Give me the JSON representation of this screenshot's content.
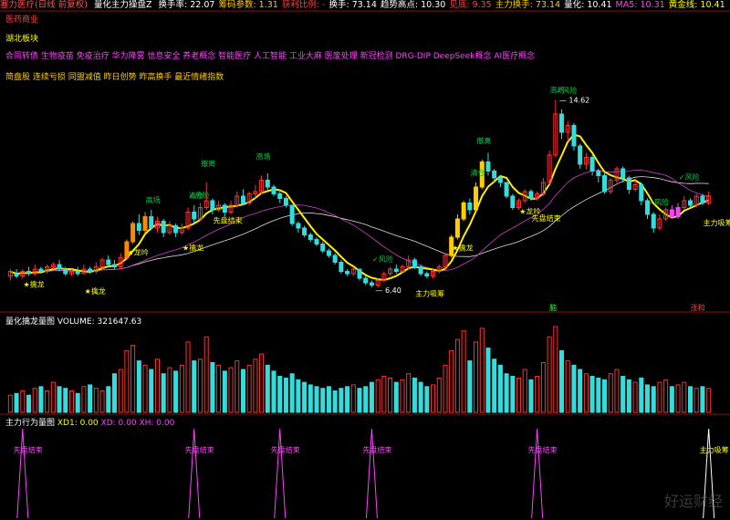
{
  "header": {
    "title": "塞力医疗(日线 前复权)",
    "indicator": "量化主力操盘Z",
    "items": [
      {
        "label": "换手率:",
        "value": "22.07",
        "color": "#ffffff"
      },
      {
        "label": "筹码参数:",
        "value": "1.31",
        "color": "#ffcc00"
      },
      {
        "label": "获利比例:",
        "value": "-",
        "color": "#ff4040"
      },
      {
        "label": "换手:",
        "value": "73.14",
        "color": "#ffffff"
      },
      {
        "label": "趋势高点:",
        "value": "10.30",
        "color": "#ffffff"
      },
      {
        "label": "见底:",
        "value": "9.35",
        "color": "#ff4040"
      },
      {
        "label": "主力换手:",
        "value": "73.14",
        "color": "#ffcc00"
      },
      {
        "label": "量化:",
        "value": "10.41",
        "color": "#ffffff"
      },
      {
        "label": "MA5:",
        "value": "10.31",
        "color": "#ff40ff"
      },
      {
        "label": "黄金线:",
        "value": "10.41",
        "color": "#ffff00"
      }
    ]
  },
  "left_labels": {
    "sector": "医药商业",
    "region": "湖北板块",
    "concepts1": "合同转债 生物疫苗 免疫治疗 华为降雾 信息安全 养老概念 智能医疗 人工智能 工业大麻 医废处理 新冠检测 DRG-DIP DeepSeek概念 AI医疗概念",
    "concepts2": "简盘股 连续亏损 同盟减值 昨日创势 昨高换手 最近情绪指数"
  },
  "chart_data": {
    "type": "candlestick",
    "price_axis": {
      "min": 5.8,
      "max": 15.2
    },
    "markers": {
      "high": "14.62",
      "low": "6.40"
    },
    "candles": [
      [
        6.9,
        7.1,
        7.2,
        6.7
      ],
      [
        7.0,
        6.9,
        7.2,
        6.8
      ],
      [
        6.9,
        7.1,
        7.2,
        6.8
      ],
      [
        7.1,
        7.0,
        7.3,
        6.9
      ],
      [
        7.0,
        7.2,
        7.4,
        6.9
      ],
      [
        7.2,
        7.1,
        7.3,
        7.0
      ],
      [
        7.1,
        7.3,
        7.4,
        7.0
      ],
      [
        7.3,
        7.4,
        7.5,
        7.2
      ],
      [
        7.4,
        7.2,
        7.6,
        7.1
      ],
      [
        7.2,
        7.0,
        7.3,
        6.9
      ],
      [
        7.0,
        7.1,
        7.2,
        6.9
      ],
      [
        7.1,
        7.0,
        7.3,
        6.9
      ],
      [
        7.0,
        7.2,
        7.4,
        7.0
      ],
      [
        7.2,
        7.1,
        7.3,
        7.0
      ],
      [
        7.1,
        7.3,
        7.5,
        7.0
      ],
      [
        7.3,
        7.6,
        7.7,
        7.2
      ],
      [
        7.6,
        7.4,
        7.8,
        7.3
      ],
      [
        7.4,
        7.3,
        7.6,
        7.2
      ],
      [
        7.3,
        7.7,
        7.9,
        7.2
      ],
      [
        7.7,
        8.4,
        8.5,
        7.6
      ],
      [
        8.4,
        9.2,
        9.3,
        8.3
      ],
      [
        9.2,
        8.9,
        9.6,
        8.7
      ],
      [
        8.9,
        9.5,
        9.7,
        8.8
      ],
      [
        9.5,
        9.0,
        9.8,
        8.9
      ],
      [
        9.0,
        9.3,
        9.5,
        8.8
      ],
      [
        9.3,
        8.8,
        9.4,
        8.6
      ],
      [
        8.8,
        9.1,
        9.3,
        8.7
      ],
      [
        9.1,
        8.8,
        9.2,
        8.6
      ],
      [
        8.8,
        9.0,
        9.2,
        8.7
      ],
      [
        9.0,
        9.7,
        9.9,
        8.9
      ],
      [
        9.7,
        9.4,
        10.0,
        9.2
      ],
      [
        9.4,
        9.9,
        10.1,
        9.3
      ],
      [
        9.9,
        10.2,
        11.0,
        9.8
      ],
      [
        10.2,
        9.8,
        10.3,
        9.6
      ],
      [
        9.8,
        10.0,
        10.2,
        9.7
      ],
      [
        10.0,
        9.7,
        10.1,
        9.5
      ],
      [
        9.7,
        10.0,
        10.2,
        9.6
      ],
      [
        10.0,
        10.4,
        10.6,
        9.9
      ],
      [
        10.4,
        10.1,
        10.7,
        10.0
      ],
      [
        10.1,
        10.5,
        10.6,
        10.0
      ],
      [
        10.5,
        10.6,
        10.9,
        10.3
      ],
      [
        10.6,
        11.1,
        11.3,
        10.5
      ],
      [
        11.1,
        10.8,
        11.4,
        10.6
      ],
      [
        10.8,
        10.5,
        10.9,
        10.4
      ],
      [
        10.5,
        10.3,
        10.6,
        10.1
      ],
      [
        10.3,
        10.0,
        10.4,
        9.9
      ],
      [
        10.0,
        9.2,
        10.0,
        9.1
      ],
      [
        9.2,
        9.0,
        9.3,
        8.8
      ],
      [
        9.0,
        8.7,
        9.1,
        8.6
      ],
      [
        8.7,
        8.5,
        8.8,
        8.4
      ],
      [
        8.5,
        8.3,
        8.6,
        8.2
      ],
      [
        8.3,
        8.0,
        8.4,
        7.9
      ],
      [
        8.0,
        7.8,
        8.1,
        7.7
      ],
      [
        7.8,
        7.5,
        7.9,
        7.4
      ],
      [
        7.5,
        7.1,
        7.6,
        7.0
      ],
      [
        7.1,
        7.0,
        7.2,
        6.9
      ],
      [
        7.0,
        7.2,
        7.3,
        6.9
      ],
      [
        7.2,
        6.8,
        7.2,
        6.7
      ],
      [
        6.8,
        6.6,
        6.9,
        6.5
      ],
      [
        6.6,
        6.5,
        6.7,
        6.4
      ],
      [
        6.5,
        6.7,
        6.8,
        6.4
      ],
      [
        6.7,
        7.0,
        7.1,
        6.6
      ],
      [
        7.0,
        7.2,
        7.3,
        6.9
      ],
      [
        7.2,
        7.1,
        7.4,
        7.0
      ],
      [
        7.1,
        7.3,
        7.4,
        7.0
      ],
      [
        7.3,
        7.6,
        7.8,
        7.2
      ],
      [
        7.6,
        7.3,
        7.7,
        7.2
      ],
      [
        7.3,
        7.0,
        7.4,
        6.9
      ],
      [
        7.0,
        6.9,
        7.1,
        6.8
      ],
      [
        6.9,
        7.1,
        7.2,
        6.8
      ],
      [
        7.1,
        7.3,
        7.4,
        7.0
      ],
      [
        7.3,
        7.8,
        7.9,
        7.2
      ],
      [
        7.8,
        8.6,
        8.7,
        7.7
      ],
      [
        8.6,
        9.4,
        9.6,
        8.5
      ],
      [
        9.4,
        10.1,
        10.2,
        9.3
      ],
      [
        10.1,
        9.8,
        10.3,
        9.6
      ],
      [
        9.8,
        10.8,
        11.0,
        9.7
      ],
      [
        10.8,
        11.9,
        12.0,
        10.7
      ],
      [
        11.9,
        11.5,
        12.3,
        11.3
      ],
      [
        11.5,
        11.2,
        11.6,
        11.0
      ],
      [
        11.2,
        11.0,
        11.3,
        10.8
      ],
      [
        11.0,
        10.4,
        11.0,
        10.3
      ],
      [
        10.4,
        9.9,
        10.5,
        9.8
      ],
      [
        9.9,
        10.2,
        10.3,
        9.8
      ],
      [
        10.2,
        10.6,
        10.7,
        10.1
      ],
      [
        10.6,
        10.3,
        10.7,
        10.2
      ],
      [
        10.3,
        10.5,
        10.6,
        10.2
      ],
      [
        10.5,
        11.0,
        11.2,
        10.4
      ],
      [
        11.0,
        12.2,
        12.4,
        10.9
      ],
      [
        12.2,
        14.0,
        14.62,
        12.1
      ],
      [
        14.0,
        13.2,
        14.2,
        12.9
      ],
      [
        13.2,
        13.5,
        13.7,
        12.8
      ],
      [
        13.5,
        12.6,
        13.6,
        12.4
      ],
      [
        12.6,
        11.8,
        12.7,
        11.6
      ],
      [
        11.8,
        12.1,
        12.3,
        11.6
      ],
      [
        12.1,
        11.5,
        12.2,
        11.3
      ],
      [
        11.5,
        11.3,
        11.6,
        11.0
      ],
      [
        11.3,
        10.6,
        11.4,
        10.5
      ],
      [
        10.6,
        11.1,
        11.2,
        10.5
      ],
      [
        11.1,
        11.6,
        11.7,
        10.9
      ],
      [
        11.6,
        11.2,
        11.7,
        11.0
      ],
      [
        11.2,
        10.7,
        11.3,
        10.5
      ],
      [
        10.7,
        10.9,
        11.1,
        10.6
      ],
      [
        10.9,
        10.2,
        11.0,
        10.0
      ],
      [
        10.2,
        9.6,
        10.3,
        9.4
      ],
      [
        9.6,
        9.0,
        9.7,
        8.8
      ],
      [
        9.0,
        9.4,
        9.6,
        8.9
      ],
      [
        9.4,
        9.8,
        9.9,
        9.3
      ],
      [
        9.8,
        9.5,
        10.0,
        9.4
      ],
      [
        9.5,
        9.9,
        10.1,
        9.4
      ],
      [
        9.9,
        10.2,
        10.4,
        9.8
      ],
      [
        10.2,
        10.0,
        10.3,
        9.9
      ],
      [
        10.0,
        10.4,
        10.5,
        9.9
      ],
      [
        10.4,
        10.1,
        10.5,
        10.0
      ],
      [
        10.1,
        10.41,
        10.6,
        10.0
      ]
    ],
    "volume": {
      "title": "量化擒龙量图",
      "label": "VOLUME:",
      "value": "321647.63",
      "bars": [
        0.2,
        0.22,
        0.25,
        0.2,
        0.28,
        0.3,
        0.25,
        0.35,
        0.3,
        0.28,
        0.25,
        0.22,
        0.3,
        0.32,
        0.28,
        0.25,
        0.3,
        0.45,
        0.5,
        0.72,
        0.78,
        0.6,
        0.55,
        0.5,
        0.62,
        0.45,
        0.52,
        0.48,
        0.55,
        0.82,
        0.6,
        0.62,
        0.88,
        0.58,
        0.55,
        0.48,
        0.52,
        0.6,
        0.5,
        0.55,
        0.62,
        0.68,
        0.55,
        0.48,
        0.42,
        0.4,
        0.45,
        0.38,
        0.35,
        0.32,
        0.3,
        0.28,
        0.3,
        0.25,
        0.28,
        0.3,
        0.32,
        0.28,
        0.3,
        0.35,
        0.38,
        0.42,
        0.4,
        0.35,
        0.38,
        0.45,
        0.4,
        0.35,
        0.3,
        0.32,
        0.4,
        0.55,
        0.72,
        0.85,
        0.95,
        0.6,
        0.82,
        0.98,
        0.75,
        0.62,
        0.55,
        0.45,
        0.42,
        0.4,
        0.5,
        0.38,
        0.42,
        0.58,
        0.88,
        1.0,
        0.72,
        0.6,
        0.55,
        0.5,
        0.45,
        0.42,
        0.4,
        0.38,
        0.45,
        0.5,
        0.42,
        0.38,
        0.35,
        0.4,
        0.32,
        0.3,
        0.35,
        0.38,
        0.3,
        0.32,
        0.35,
        0.3,
        0.28,
        0.3,
        0.28
      ]
    },
    "lower_panel": {
      "title": "主力行为量图",
      "xd1": "XD1: 0.00",
      "xd": "XD: 0.00",
      "xh": "XH: 0.00",
      "spike_label": "先盘结束",
      "last_spike_label": "主力吸筹",
      "spikes": [
        2,
        30,
        44,
        59,
        86,
        114
      ]
    },
    "annotations": [
      {
        "i": 23,
        "text": "高场",
        "color": "#00cc44"
      },
      {
        "i": 41,
        "text": "高场",
        "color": "#00cc44"
      },
      {
        "i": 30,
        "text": "清仓",
        "color": "#00cc44"
      },
      {
        "i": 32,
        "text": "撤离",
        "color": "#00cc44"
      },
      {
        "i": 76,
        "text": "清仓",
        "color": "#00cc44"
      },
      {
        "i": 77,
        "text": "撤离",
        "color": "#00cc44"
      },
      {
        "i": 89,
        "text": "高场",
        "color": "#00cc44"
      },
      {
        "i": 90,
        "text": "✓风险",
        "color": "#00cc44"
      },
      {
        "i": 30,
        "text": "✓风险",
        "color": "#00cc44"
      },
      {
        "i": 60,
        "text": "✓风险",
        "color": "#00cc44"
      },
      {
        "i": 105,
        "text": "✓风险",
        "color": "#00cc44"
      },
      {
        "i": 110,
        "text": "✓风险",
        "color": "#00cc44"
      },
      {
        "i": 3,
        "text": "★擒龙",
        "color": "#ffff00"
      },
      {
        "i": 13,
        "text": "★擒龙",
        "color": "#ffff00"
      },
      {
        "i": 20,
        "text": "★龙吟",
        "color": "#ffff00"
      },
      {
        "i": 29,
        "text": "★擒龙",
        "color": "#ffff00"
      },
      {
        "i": 34,
        "text": "先盘结束",
        "color": "#ffff00"
      },
      {
        "i": 67,
        "text": "主力吸筹",
        "color": "#ffff00"
      },
      {
        "i": 73,
        "text": "★擒龙",
        "color": "#ffff00"
      },
      {
        "i": 86,
        "text": "先盘结束",
        "color": "#ffff00"
      },
      {
        "i": 84,
        "text": "★龙吟",
        "color": "#ffff00"
      },
      {
        "i": 114,
        "text": "主力吸筹",
        "color": "#ffff00"
      }
    ],
    "footer_tags": {
      "left": "脑",
      "right": "涨和"
    },
    "watermark": "好运财经"
  }
}
